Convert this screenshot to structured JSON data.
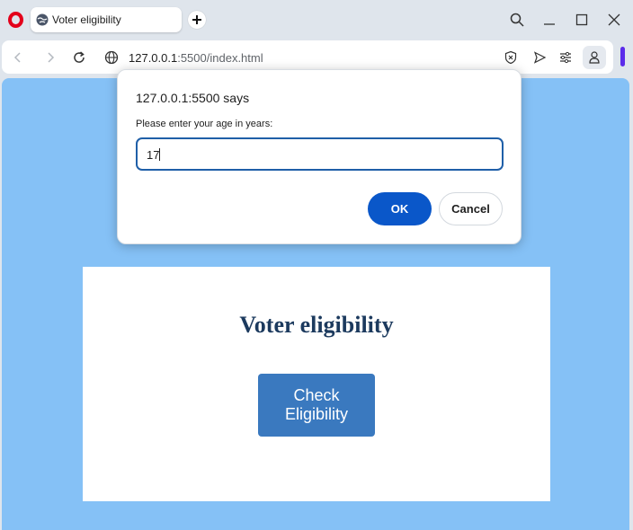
{
  "browser": {
    "tab": {
      "title": "Voter eligibility",
      "favicon": "globe-icon"
    },
    "address": {
      "host": "127.0.0.1",
      "rest": ":5500/index.html"
    },
    "colors": {
      "accent": "#e3001b",
      "sidebar_accent": "#5b2bea"
    }
  },
  "dialog": {
    "title": "127.0.0.1:5500 says",
    "message": "Please enter your age in years:",
    "input_value": "17",
    "ok_label": "OK",
    "cancel_label": "Cancel"
  },
  "page": {
    "title": "Voter eligibility",
    "button_line1": "Check",
    "button_line2": "Eligibility",
    "colors": {
      "background": "#85c1f6",
      "button": "#3a79bf",
      "title": "#1c3a5e"
    }
  }
}
